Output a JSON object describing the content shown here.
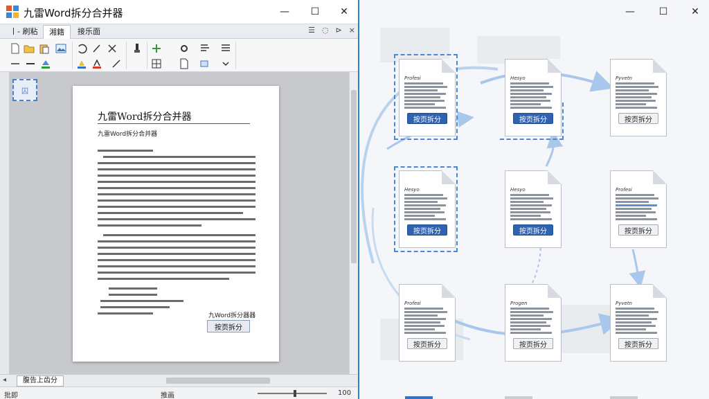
{
  "left_window": {
    "title": "九雷Word拆分合并器",
    "controls": {
      "minimize": "—",
      "maximize": "☐",
      "close": "✕"
    },
    "tabs": [
      {
        "label": "丨- 刷粘"
      },
      {
        "label": "湘籍"
      },
      {
        "label": "接乐面"
      }
    ],
    "document": {
      "title": "九雷Word拆分合并器",
      "subtitle": "九雷Word拆分合并器",
      "footer_title": "九Word拆分器器",
      "button_label": "按页拆分"
    },
    "nav_thumb_label": "囚",
    "sheet_tab": "腹告上齿分",
    "status_left": "批即",
    "status_mid": "推画",
    "zoom_value": "100"
  },
  "right_window": {
    "controls": {
      "minimize": "—",
      "maximize": "☐",
      "close": "✕"
    },
    "cards": [
      {
        "title": "Profesi",
        "button": "按页拆分",
        "style": "primary"
      },
      {
        "title": "Hesyo",
        "button": "按页拆分",
        "style": "primary"
      },
      {
        "title": "Pyvetn",
        "button": "按页拆分",
        "style": "plain"
      },
      {
        "title": "Hesyo",
        "button": "按页拆分",
        "style": "primary"
      },
      {
        "title": "Hesyo",
        "button": "按页拆分",
        "style": "primary"
      },
      {
        "title": "Profesi",
        "button": "按页拆分",
        "style": "plain"
      },
      {
        "title": "Profesi",
        "button": "按页拆分",
        "style": "plain"
      },
      {
        "title": "Progen",
        "button": "按页拆分",
        "style": "plain"
      },
      {
        "title": "Pyvetn",
        "button": "按页拆分",
        "style": "plain"
      }
    ]
  },
  "colors": {
    "accent": "#2f63b0",
    "window_border": "#2e7fd0",
    "flow_arrow": "#a9c7ea"
  }
}
